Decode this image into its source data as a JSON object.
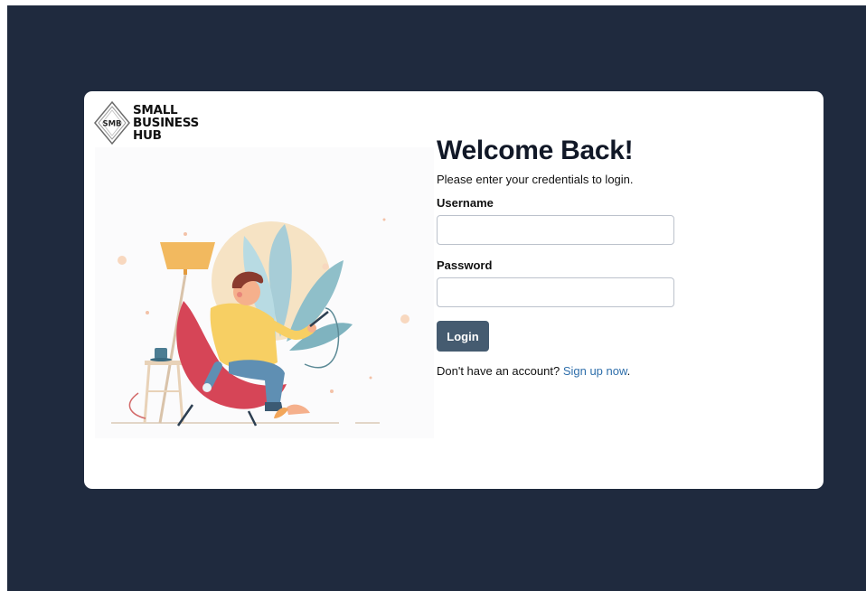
{
  "brand": {
    "badge": "SMB",
    "name_lines": [
      "SMALL",
      "BUSINESS",
      "HUB"
    ]
  },
  "login": {
    "title": "Welcome Back!",
    "subtitle": "Please enter your credentials to login.",
    "username_label": "Username",
    "username_value": "",
    "password_label": "Password",
    "password_value": "",
    "login_button": "Login",
    "signup_prompt": "Don't have an account? ",
    "signup_link": "Sign up now",
    "signup_suffix": "."
  },
  "colors": {
    "background": "#1f2a3e",
    "card": "#ffffff",
    "button": "#455b70",
    "link": "#2f6fab"
  },
  "icons": {
    "logo": "diamond-logo-icon",
    "illustration": "person-in-chair-illustration"
  }
}
